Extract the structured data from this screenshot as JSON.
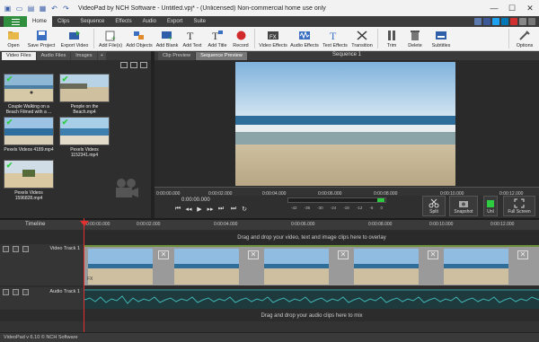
{
  "window": {
    "title": "VideoPad by NCH Software - Untitled.vpj* - (Unlicensed) Non-commercial home use only",
    "controls": [
      "—",
      "☐",
      "✕"
    ]
  },
  "menu": {
    "tabs": [
      "Home",
      "Clips",
      "Sequence",
      "Effects",
      "Audio",
      "Export",
      "Suite"
    ],
    "active": "Home"
  },
  "ribbon": {
    "buttons": [
      {
        "label": "Open",
        "icon": "open-folder-icon"
      },
      {
        "label": "Save Project",
        "icon": "save-icon"
      },
      {
        "label": "Export Video",
        "icon": "export-video-icon"
      },
      {
        "label": "Add File(s)",
        "icon": "add-files-icon"
      },
      {
        "label": "Add Objects",
        "icon": "add-objects-icon"
      },
      {
        "label": "Add Blank",
        "icon": "add-blank-icon"
      },
      {
        "label": "Add Text",
        "icon": "add-text-icon"
      },
      {
        "label": "Add Title",
        "icon": "add-title-icon"
      },
      {
        "label": "Record",
        "icon": "record-icon"
      },
      {
        "label": "Video Effects",
        "icon": "video-effects-icon"
      },
      {
        "label": "Audio Effects",
        "icon": "audio-effects-icon"
      },
      {
        "label": "Text Effects",
        "icon": "text-effects-icon"
      },
      {
        "label": "Transition",
        "icon": "transition-icon"
      },
      {
        "label": "Trim",
        "icon": "trim-icon"
      },
      {
        "label": "Delete",
        "icon": "delete-icon"
      },
      {
        "label": "Subtitles",
        "icon": "subtitles-icon"
      },
      {
        "label": "Options",
        "icon": "options-icon"
      }
    ]
  },
  "media": {
    "tabs": [
      "Video Files",
      "Audio Files",
      "Images",
      "+"
    ],
    "active": "Video Files",
    "clips": [
      {
        "caption": "Couple Walking on a Beach Filmed with a ...",
        "checked": true
      },
      {
        "caption": "People on the Beach.mp4",
        "checked": true
      },
      {
        "caption": "Pexels Videos 4189.mp4",
        "checked": true
      },
      {
        "caption": "Pexels Videos 1152341.mp4",
        "checked": true
      },
      {
        "caption": "Pexels Videos 1596828.mp4",
        "checked": true
      }
    ]
  },
  "preview": {
    "tabs": [
      "Clip Preview",
      "Sequence Preview"
    ],
    "active": "Sequence Preview",
    "sequence_title": "Sequence 1",
    "ruler_ticks": [
      "0:00:00.000",
      "0:00:02.000",
      "0:00:04.000",
      "0:00:06.000",
      "0:00:08.000",
      "0:00:10.000",
      "0:00:12.000"
    ],
    "timecode": "0:00:00.000",
    "meter_labels": [
      "-42",
      "-36",
      "-30",
      "-24",
      "-18",
      "-12",
      "-6",
      "0"
    ],
    "tools": [
      {
        "label": "Split",
        "icon": "split-scissors-icon"
      },
      {
        "label": "Snapshot",
        "icon": "snapshot-icon"
      },
      {
        "label": "Unl",
        "icon": "unlink-icon"
      },
      {
        "label": "Full Screen",
        "icon": "fullscreen-icon"
      }
    ]
  },
  "timeline": {
    "label": "Timeline",
    "ticks": [
      "0:00:00.000",
      "0:00:02.000",
      "0:00:04.000",
      "0:00:06.000",
      "0:00:08.000",
      "0:00:10.000",
      "0:00:12.000"
    ],
    "overlay_hint": "Drag and drop your video, text and image clips here to overlay",
    "video_track": "Video Track 1",
    "audio_track": "Audio Track 1",
    "audio_hint": "Drag and drop your audio clips here to mix",
    "fx_label": "FX"
  },
  "status": {
    "text": "VideoPad v 6.10 © NCH Software"
  }
}
